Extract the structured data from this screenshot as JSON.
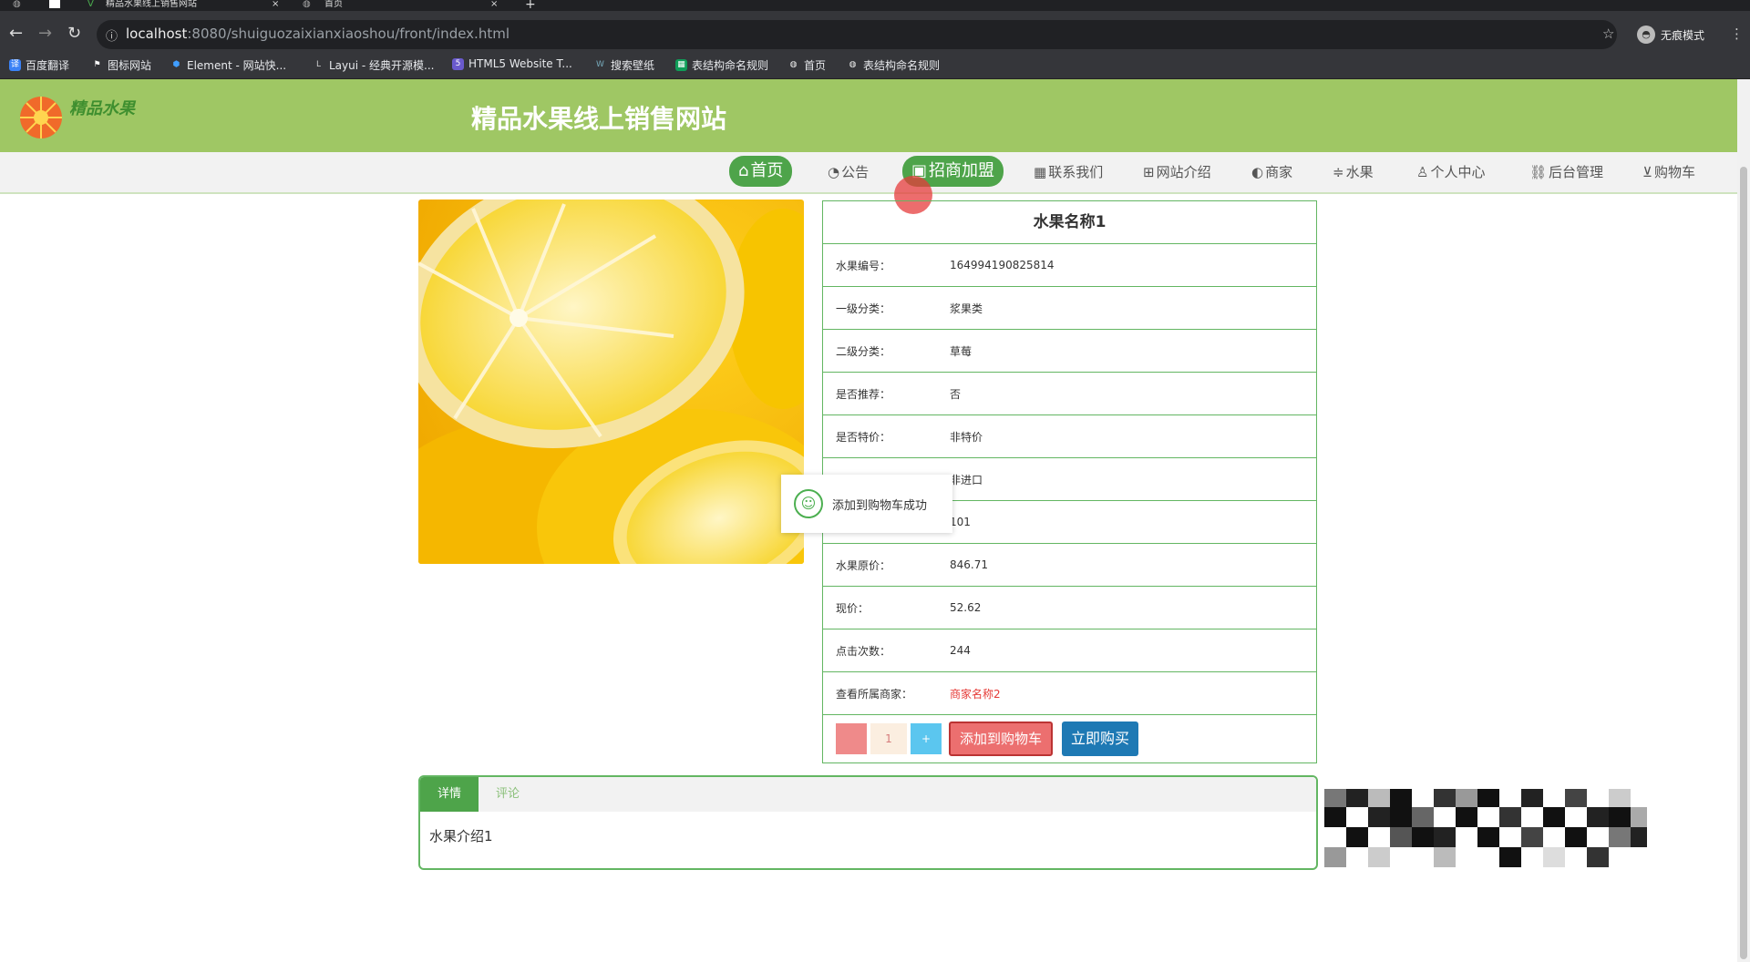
{
  "browser": {
    "tabs": [
      {
        "title": "精品水果线上销售网站"
      },
      {
        "title": "首页"
      }
    ],
    "url_host": "localhost",
    "url_rest": ":8080/shuiguozaixianxiaoshou/front/index.html",
    "profile_label": "无痕模式",
    "bookmarks": [
      {
        "label": "百度翻译",
        "icon": "translate-icon",
        "color": "#3b82f6"
      },
      {
        "label": "图标网站",
        "icon": "flag-icon",
        "color": "#444444"
      },
      {
        "label": "Element - 网站快...",
        "icon": "element-icon",
        "color": "#409eff"
      },
      {
        "label": "Layui - 经典开源模...",
        "icon": "layui-icon",
        "color": "#666666"
      },
      {
        "label": "HTML5 Website T...",
        "icon": "html5-icon",
        "color": "#6a5acd"
      },
      {
        "label": "搜索壁纸",
        "icon": "wallpaper-icon",
        "color": "#2b6cb0"
      },
      {
        "label": "表结构命名规则",
        "icon": "sheet-icon",
        "color": "#0f9d58"
      },
      {
        "label": "首页",
        "icon": "globe-icon",
        "color": "#888888"
      },
      {
        "label": "表结构命名规则",
        "icon": "globe-icon",
        "color": "#888888"
      }
    ]
  },
  "site": {
    "title": "精品水果线上销售网站",
    "logo_text": "精品水果",
    "header_color": "#9fc764",
    "accent_color": "#4ea44a"
  },
  "nav": [
    {
      "label": "首页",
      "icon": "home-icon",
      "active": true
    },
    {
      "label": "公告",
      "icon": "speedometer-icon",
      "active": false
    },
    {
      "label": "招商加盟",
      "icon": "join-icon",
      "active": true
    },
    {
      "label": "联系我们",
      "icon": "grid-icon",
      "active": false
    },
    {
      "label": "网站介绍",
      "icon": "apps-icon",
      "active": false
    },
    {
      "label": "商家",
      "icon": "palette-icon",
      "active": false
    },
    {
      "label": "水果",
      "icon": "sliders-icon",
      "active": false
    },
    {
      "label": "个人中心",
      "icon": "user-icon",
      "active": false
    },
    {
      "label": "后台管理",
      "icon": "link-icon",
      "active": false
    },
    {
      "label": "购物车",
      "icon": "cart-icon",
      "active": false
    }
  ],
  "product": {
    "name": "水果名称1",
    "fields": [
      {
        "key": "水果编号：",
        "value": "164994190825814"
      },
      {
        "key": "一级分类：",
        "value": "浆果类"
      },
      {
        "key": "二级分类：",
        "value": "草莓"
      },
      {
        "key": "是否推荐：",
        "value": "否"
      },
      {
        "key": "是否特价：",
        "value": "非特价"
      },
      {
        "key": "",
        "value": "非进口"
      },
      {
        "key": "",
        "value": "101"
      },
      {
        "key": "水果原价：",
        "value": "846.71"
      },
      {
        "key": "现价：",
        "value": "52.62"
      },
      {
        "key": "点击次数：",
        "value": "244"
      },
      {
        "key": "查看所属商家：",
        "value": "商家名称2"
      }
    ],
    "quantity": "1",
    "minus_label": "",
    "plus_label": "+",
    "add_cart_label": "添加到购物车",
    "buy_label": "立即购买"
  },
  "toast": {
    "message": "添加到购物车成功"
  },
  "detail_tabs": [
    {
      "label": "详情",
      "active": true
    },
    {
      "label": "评论",
      "active": false
    }
  ],
  "detail_text": "水果介绍1"
}
